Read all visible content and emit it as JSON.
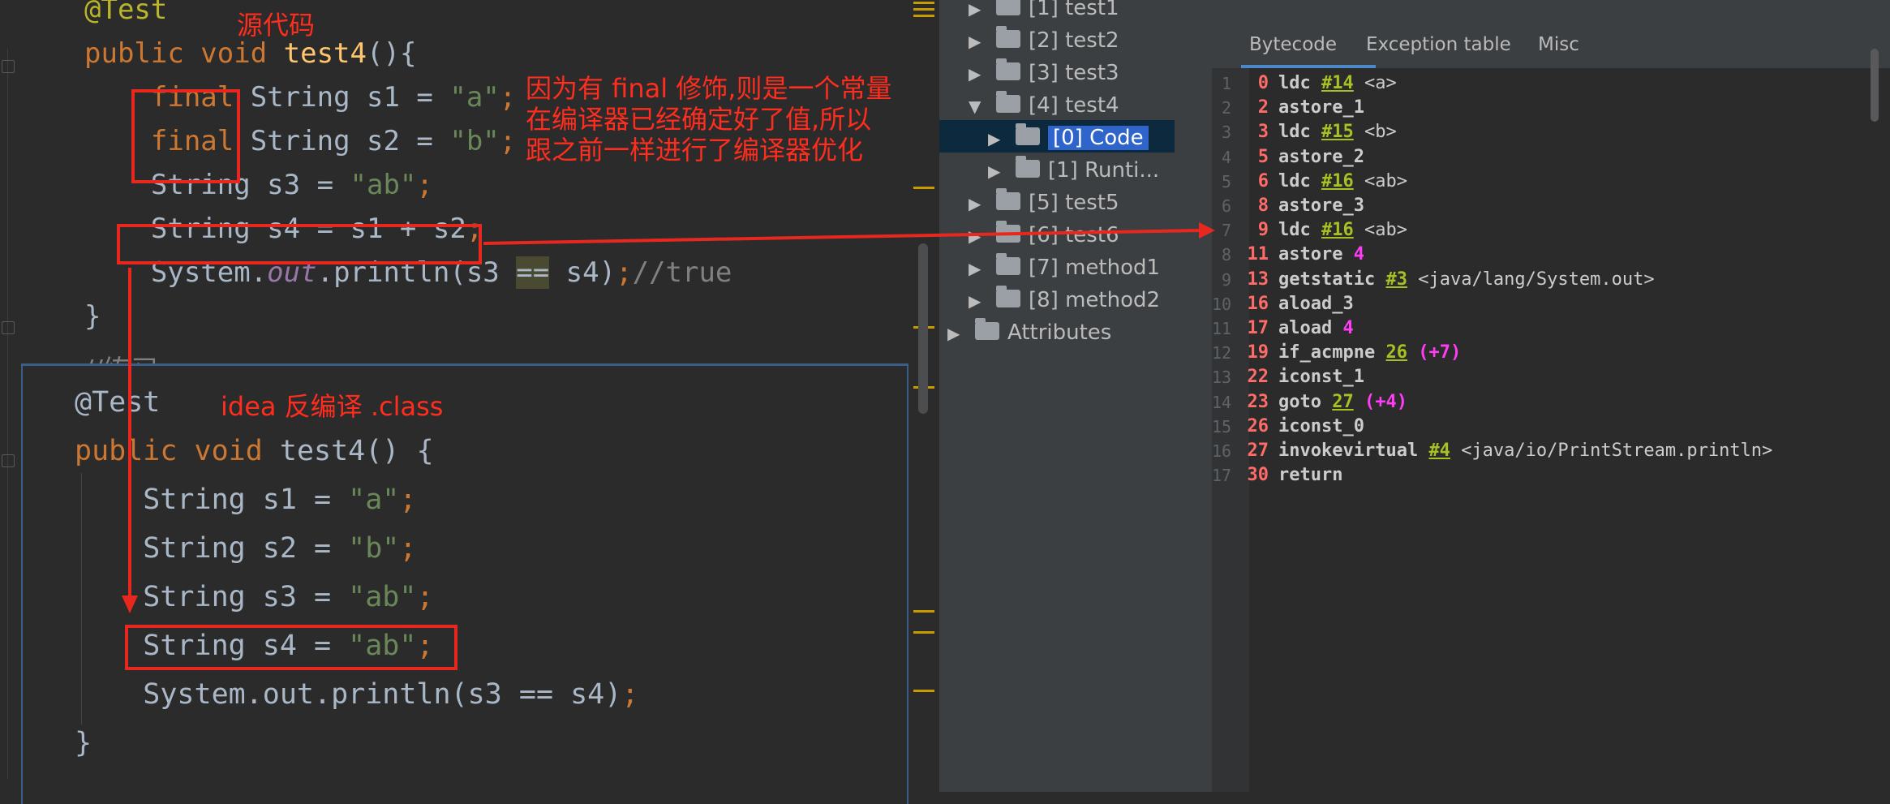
{
  "editor": {
    "lines": [
      {
        "segments": [
          {
            "c": "ann",
            "t": "@Test"
          }
        ]
      },
      {
        "segments": [
          {
            "c": "kw",
            "t": "public void "
          },
          {
            "c": "fn",
            "t": "test4"
          },
          {
            "c": "",
            "t": "(){"
          }
        ]
      },
      {
        "segments": [
          {
            "c": "",
            "t": "    "
          },
          {
            "c": "kw",
            "t": "final"
          },
          {
            "c": "",
            "t": " String s1 = "
          },
          {
            "c": "str",
            "t": "\"a\""
          },
          {
            "c": "kw",
            "t": ";"
          }
        ]
      },
      {
        "segments": [
          {
            "c": "",
            "t": "    "
          },
          {
            "c": "kw",
            "t": "final"
          },
          {
            "c": "",
            "t": " String s2 = "
          },
          {
            "c": "str",
            "t": "\"b\""
          },
          {
            "c": "kw",
            "t": ";"
          }
        ]
      },
      {
        "segments": [
          {
            "c": "",
            "t": "    String s3 = "
          },
          {
            "c": "str",
            "t": "\"ab\""
          },
          {
            "c": "kw",
            "t": ";"
          }
        ]
      },
      {
        "segments": [
          {
            "c": "",
            "t": "    String s4 = s1 + s2"
          },
          {
            "c": "kw",
            "t": ";"
          }
        ]
      },
      {
        "segments": [
          {
            "c": "",
            "t": "    System."
          },
          {
            "c": "fld",
            "t": "out"
          },
          {
            "c": "",
            "t": ".println(s3 "
          },
          {
            "c": "hl",
            "t": "=="
          },
          {
            "c": "",
            "t": " s4)"
          },
          {
            "c": "kw",
            "t": ";"
          },
          {
            "c": "cmt",
            "t": "//true"
          }
        ]
      },
      {
        "segments": [
          {
            "c": "",
            "t": "}"
          }
        ]
      }
    ],
    "partial_line": "//练习"
  },
  "decompiled": {
    "lines": [
      {
        "segments": [
          {
            "c": "",
            "t": "@Test"
          }
        ]
      },
      {
        "segments": [
          {
            "c": "kw",
            "t": "public void "
          },
          {
            "c": "",
            "t": "test4() {"
          }
        ]
      },
      {
        "segments": [
          {
            "c": "",
            "t": "    String s1 = "
          },
          {
            "c": "str",
            "t": "\"a\""
          },
          {
            "c": "kw",
            "t": ";"
          }
        ]
      },
      {
        "segments": [
          {
            "c": "",
            "t": "    String s2 = "
          },
          {
            "c": "str",
            "t": "\"b\""
          },
          {
            "c": "kw",
            "t": ";"
          }
        ]
      },
      {
        "segments": [
          {
            "c": "",
            "t": "    String s3 = "
          },
          {
            "c": "str",
            "t": "\"ab\""
          },
          {
            "c": "kw",
            "t": ";"
          }
        ]
      },
      {
        "segments": [
          {
            "c": "",
            "t": "    String s4 = "
          },
          {
            "c": "str",
            "t": "\"ab\""
          },
          {
            "c": "kw",
            "t": ";"
          }
        ]
      },
      {
        "segments": [
          {
            "c": "",
            "t": "    System.out.println(s3 == s4)"
          },
          {
            "c": "kw",
            "t": ";"
          }
        ]
      },
      {
        "segments": [
          {
            "c": "",
            "t": "}"
          }
        ]
      }
    ]
  },
  "annotations": {
    "source_label": "源代码",
    "explanation": "因为有 final 修饰,则是一个常量\n在编译器已经确定好了值,所以\n跟之前一样进行了编译器优化",
    "decompile_label": "idea 反编译 .class"
  },
  "tree": {
    "items": [
      {
        "label": "[1] test1",
        "expanded": false
      },
      {
        "label": "[2] test2",
        "expanded": false
      },
      {
        "label": "[3] test3",
        "expanded": false
      },
      {
        "label": "[4] test4",
        "expanded": true
      },
      {
        "label": "[0] Code",
        "expanded": false,
        "selected": true
      },
      {
        "label": "[1] Runti...",
        "expanded": false
      },
      {
        "label": "[5] test5",
        "expanded": false
      },
      {
        "label": "[6] test6",
        "expanded": false
      },
      {
        "label": "[7] method1",
        "expanded": false
      },
      {
        "label": "[8] method2",
        "expanded": false
      },
      {
        "label": "Attributes",
        "expanded": false
      }
    ]
  },
  "bytecode": {
    "tabs": [
      "Bytecode",
      "Exception table",
      "Misc"
    ],
    "active_tab": "Bytecode",
    "lines": [
      {
        "n": "1",
        "off": "0",
        "ins": "ldc",
        "ref": "#14",
        "cmt": "<a>"
      },
      {
        "n": "2",
        "off": "2",
        "ins": "astore_1"
      },
      {
        "n": "3",
        "off": "3",
        "ins": "ldc",
        "ref": "#15",
        "cmt": "<b>"
      },
      {
        "n": "4",
        "off": "5",
        "ins": "astore_2"
      },
      {
        "n": "5",
        "off": "6",
        "ins": "ldc",
        "ref": "#16",
        "cmt": "<ab>"
      },
      {
        "n": "6",
        "off": "8",
        "ins": "astore_3"
      },
      {
        "n": "7",
        "off": "9",
        "ins": "ldc",
        "ref": "#16",
        "cmt": "<ab>"
      },
      {
        "n": "8",
        "off": "11",
        "ins": "astore",
        "mag": "4"
      },
      {
        "n": "9",
        "off": "13",
        "ins": "getstatic",
        "ref": "#3",
        "cmt": "<java/lang/System.out>"
      },
      {
        "n": "10",
        "off": "16",
        "ins": "aload_3"
      },
      {
        "n": "11",
        "off": "17",
        "ins": "aload",
        "mag": "4"
      },
      {
        "n": "12",
        "off": "19",
        "ins": "if_acmpne",
        "ref": "26",
        "mag": "(+7)"
      },
      {
        "n": "13",
        "off": "22",
        "ins": "iconst_1"
      },
      {
        "n": "14",
        "off": "23",
        "ins": "goto",
        "ref": "27",
        "mag": "(+4)"
      },
      {
        "n": "15",
        "off": "26",
        "ins": "iconst_0"
      },
      {
        "n": "16",
        "off": "27",
        "ins": "invokevirtual",
        "ref": "#4",
        "cmt": "<java/io/PrintStream.println>"
      },
      {
        "n": "17",
        "off": "30",
        "ins": "return"
      }
    ]
  },
  "colors": {
    "annotation_red": "#e8281e",
    "selection": "#2f65ca"
  }
}
